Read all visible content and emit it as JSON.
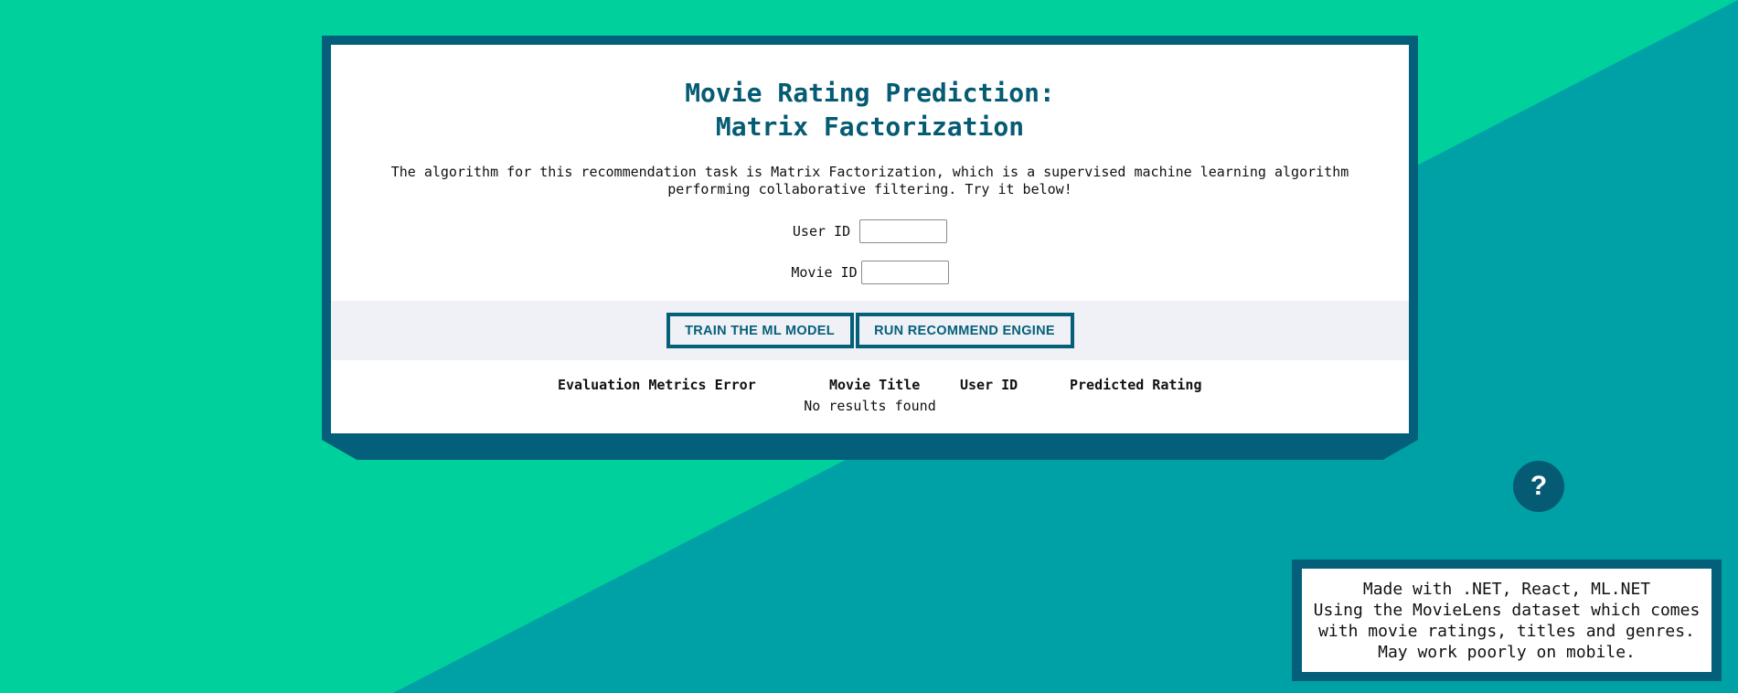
{
  "theme": {
    "bg_light": "#00d09c",
    "bg_dark": "#00a1a6",
    "accent": "#04607a",
    "title_color": "#055b73",
    "button_band": "#f0f1f6"
  },
  "header": {
    "title_line1": "Movie Rating Prediction:",
    "title_line2": "Matrix Factorization"
  },
  "description": "The algorithm for this recommendation task is Matrix Factorization, which is a supervised machine learning algorithm performing collaborative filtering. Try it below!",
  "form": {
    "user_id_label": "User ID",
    "user_id_value": "",
    "movie_id_label": "Movie ID",
    "movie_id_value": ""
  },
  "buttons": {
    "train_label": "TRAIN THE ML MODEL",
    "run_label": "RUN RECOMMEND ENGINE"
  },
  "results": {
    "columns": [
      "Evaluation Metrics Error",
      "Movie Title",
      "User ID",
      "Predicted Rating"
    ],
    "empty_text": "No results found"
  },
  "help": {
    "icon": "question-mark-icon",
    "label": "?"
  },
  "footer": {
    "lines": [
      "Made with .NET, React, ML.NET",
      "Using the MovieLens dataset which comes",
      "with movie ratings, titles and genres.",
      "May work poorly on mobile."
    ]
  }
}
